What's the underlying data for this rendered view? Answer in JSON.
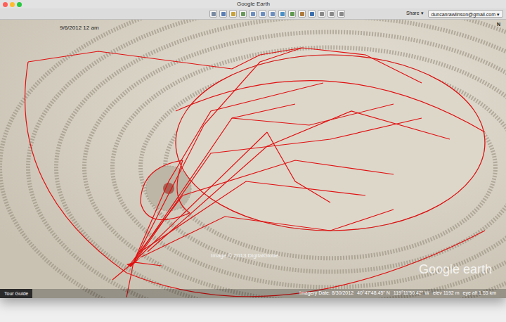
{
  "window": {
    "title": "Google Earth"
  },
  "window_buttons": [
    {
      "name": "close",
      "color": "#ff5f57"
    },
    {
      "name": "minimize",
      "color": "#febc2e"
    },
    {
      "name": "zoom",
      "color": "#28c840"
    }
  ],
  "toolbar": {
    "share": "Share ▾",
    "account": "duncanrawlinson@gmail.com ▾"
  },
  "map": {
    "timestamp": "9/6/2012 12 am",
    "compass": "N",
    "attribution": "Image © 2013 DigitalGlobe",
    "logo": "Google earth"
  },
  "tour_guide": "Tour Guide",
  "status_bar": {
    "imagery_date": "Imagery Date: 8/30/2012",
    "lat": "40°47'48.45\" N",
    "lon": "119°11'50.42\" W",
    "elev": "elev 1192 m",
    "eye_alt": "eye alt 1.53 km"
  }
}
